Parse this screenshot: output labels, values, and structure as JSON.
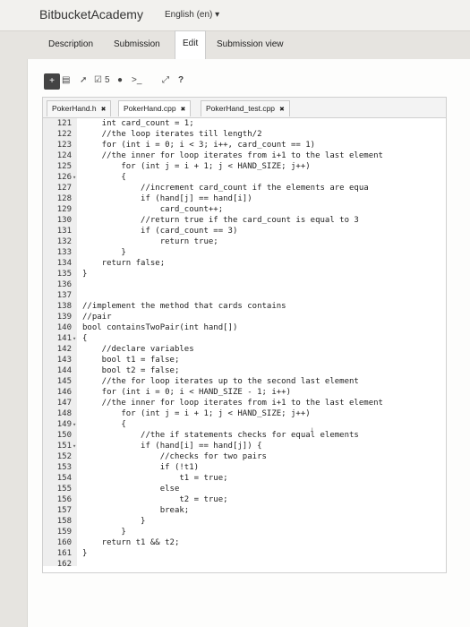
{
  "header": {
    "brand": "BitbucketAcademy",
    "language": "English (en)"
  },
  "tabs": [
    {
      "label": "Description"
    },
    {
      "label": "Submission"
    },
    {
      "label": "Edit"
    },
    {
      "label": "Submission view"
    }
  ],
  "toolbar": {
    "count": "5",
    "help": "?"
  },
  "file_tabs": [
    {
      "label": "PokerHand.h"
    },
    {
      "label": "PokerHand.cpp"
    },
    {
      "label": "PokerHand_test.cpp"
    }
  ],
  "code_lines": [
    {
      "n": "121",
      "fold": "",
      "text": "    int card_count = 1;"
    },
    {
      "n": "122",
      "fold": "",
      "text": "    //the loop iterates till length/2"
    },
    {
      "n": "123",
      "fold": "",
      "text": "    for (int i = 0; i < 3; i++, card_count == 1)"
    },
    {
      "n": "124",
      "fold": "",
      "text": "    //the inner for loop iterates from i+1 to the last element"
    },
    {
      "n": "125",
      "fold": "",
      "text": "        for (int j = i + 1; j < HAND_SIZE; j++)"
    },
    {
      "n": "126",
      "fold": "▾",
      "text": "        {"
    },
    {
      "n": "127",
      "fold": "",
      "text": "            //increment card_count if the elements are equa"
    },
    {
      "n": "128",
      "fold": "",
      "text": "            if (hand[j] == hand[i])"
    },
    {
      "n": "129",
      "fold": "",
      "text": "                card_count++;"
    },
    {
      "n": "130",
      "fold": "",
      "text": "            //return true if the card_count is equal to 3"
    },
    {
      "n": "131",
      "fold": "",
      "text": "            if (card_count == 3)"
    },
    {
      "n": "132",
      "fold": "",
      "text": "                return true;"
    },
    {
      "n": "133",
      "fold": "",
      "text": "        }"
    },
    {
      "n": "134",
      "fold": "",
      "text": "    return false;"
    },
    {
      "n": "135",
      "fold": "",
      "text": "}"
    },
    {
      "n": "136",
      "fold": "",
      "text": ""
    },
    {
      "n": "137",
      "fold": "",
      "text": ""
    },
    {
      "n": "138",
      "fold": "",
      "text": "//implement the method that cards contains"
    },
    {
      "n": "139",
      "fold": "",
      "text": "//pair"
    },
    {
      "n": "140",
      "fold": "",
      "text": "bool containsTwoPair(int hand[])"
    },
    {
      "n": "141",
      "fold": "▾",
      "text": "{"
    },
    {
      "n": "142",
      "fold": "",
      "text": "    //declare variables"
    },
    {
      "n": "143",
      "fold": "",
      "text": "    bool t1 = false;"
    },
    {
      "n": "144",
      "fold": "",
      "text": "    bool t2 = false;"
    },
    {
      "n": "145",
      "fold": "",
      "text": "    //the for loop iterates up to the second last element"
    },
    {
      "n": "146",
      "fold": "",
      "text": "    for (int i = 0; i < HAND_SIZE - 1; i++)"
    },
    {
      "n": "147",
      "fold": "",
      "text": "    //the inner for loop iterates from i+1 to the last element"
    },
    {
      "n": "148",
      "fold": "",
      "text": "        for (int j = i + 1; j < HAND_SIZE; j++)"
    },
    {
      "n": "149",
      "fold": "▾",
      "text": "        {"
    },
    {
      "n": "150",
      "fold": "",
      "text": "            //the if statements checks for equal elements"
    },
    {
      "n": "151",
      "fold": "▾",
      "text": "            if (hand[i] == hand[j]) {"
    },
    {
      "n": "152",
      "fold": "",
      "text": "                //checks for two pairs"
    },
    {
      "n": "153",
      "fold": "",
      "text": "                if (!t1)"
    },
    {
      "n": "154",
      "fold": "",
      "text": "                    t1 = true;"
    },
    {
      "n": "155",
      "fold": "",
      "text": "                else"
    },
    {
      "n": "156",
      "fold": "",
      "text": "                    t2 = true;"
    },
    {
      "n": "157",
      "fold": "",
      "text": "                break;"
    },
    {
      "n": "158",
      "fold": "",
      "text": "            }"
    },
    {
      "n": "159",
      "fold": "",
      "text": "        }"
    },
    {
      "n": "160",
      "fold": "",
      "text": "    return t1 && t2;"
    },
    {
      "n": "161",
      "fold": "",
      "text": "}"
    },
    {
      "n": "162",
      "fold": "",
      "text": ""
    }
  ],
  "icons": [
    "plus-icon",
    "save-icon",
    "rocket-icon",
    "checkbox-icon",
    "comment-icon",
    "terminal-icon",
    "expand-icon",
    "help-icon",
    "close-icon"
  ]
}
